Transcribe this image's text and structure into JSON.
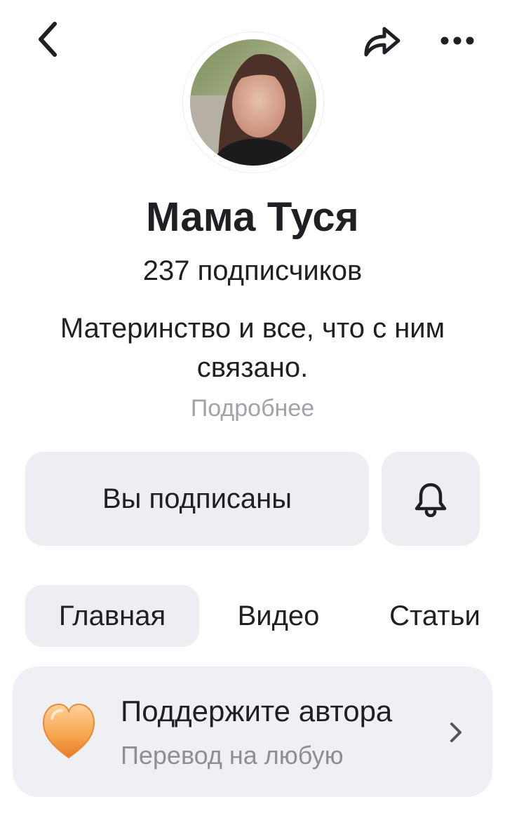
{
  "header": {
    "back_icon": "chevron-left-icon",
    "share_icon": "share-arrow-icon",
    "more_icon": "more-dots-icon"
  },
  "profile": {
    "name": "Мама Туся",
    "subscribers": "237 подписчиков",
    "description": "Материнство и все, что с ним связано.",
    "more_link": "Подробнее"
  },
  "actions": {
    "subscribed_label": "Вы подписаны",
    "bell_icon": "bell-icon"
  },
  "tabs": [
    {
      "label": "Главная",
      "active": true
    },
    {
      "label": "Видео",
      "active": false
    },
    {
      "label": "Статьи",
      "active": false
    }
  ],
  "support": {
    "title": "Поддержите автора",
    "subtitle": "Перевод на любую",
    "icon": "heart-icon",
    "heart_color": "#f59a3a"
  }
}
